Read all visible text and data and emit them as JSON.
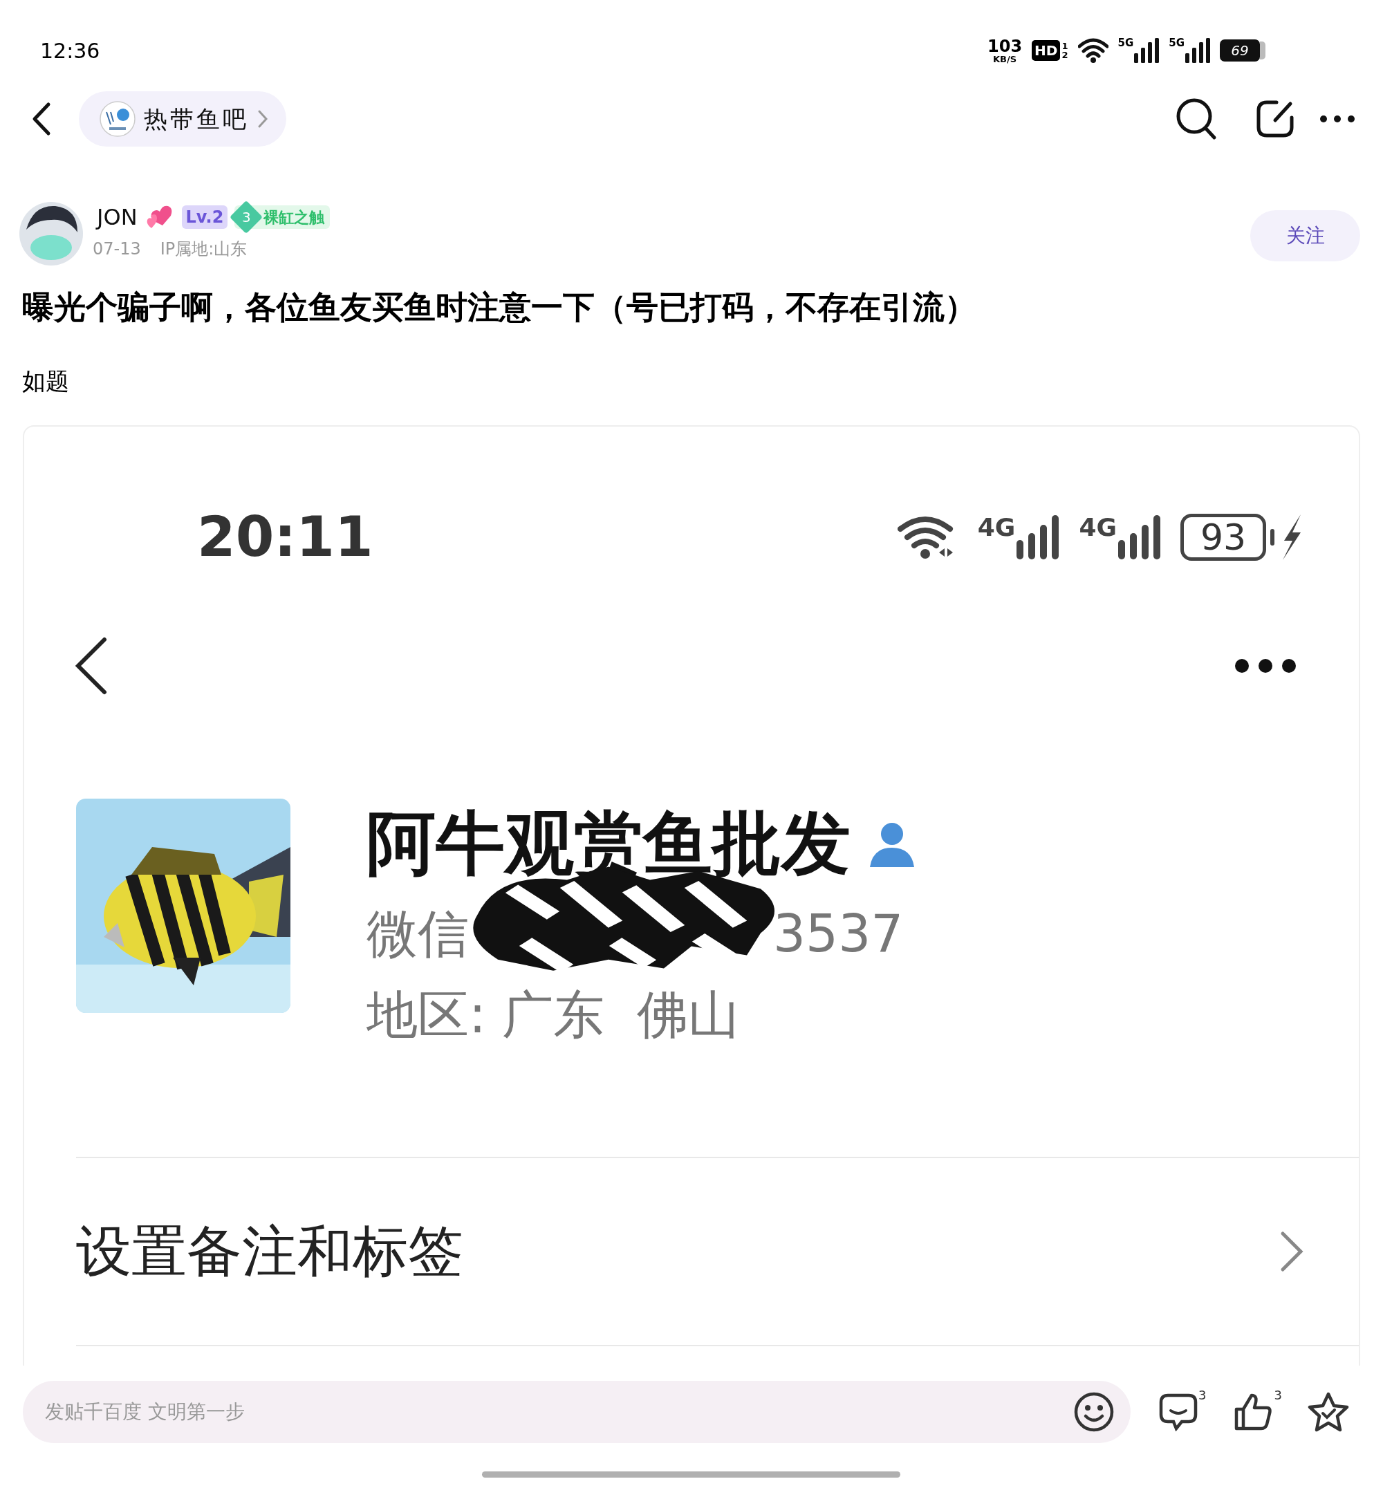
{
  "status_bar": {
    "time": "12:36",
    "net_speed": "103",
    "net_unit": "KB/S",
    "hd": "HD",
    "hd_sims": [
      "1",
      "2"
    ],
    "signals": [
      "5G",
      "5G"
    ],
    "battery": "69"
  },
  "nav": {
    "forum": "热带鱼吧"
  },
  "post": {
    "author": "JON",
    "level": "Lv.2",
    "badge_number": "3",
    "badge": "裸缸之触",
    "date": "07-13",
    "ip": "IP属地:山东",
    "follow": "关注",
    "title": "曝光个骗子啊，各位鱼友买鱼时注意一下（号已打码，不存在引流）",
    "body": "如题"
  },
  "screenshot": {
    "time": "20:11",
    "signals": [
      "4G",
      "4G"
    ],
    "battery": "93",
    "contact_name": "阿牛观赏鱼批发",
    "wechat_label": "微信",
    "wechat_tail": "3537",
    "region": "地区: 广东  佛山",
    "menu_item": "设置备注和标签"
  },
  "reply_bar": {
    "placeholder": "发贴千百度 文明第一步",
    "comment_count": "3",
    "like_count": "3"
  }
}
